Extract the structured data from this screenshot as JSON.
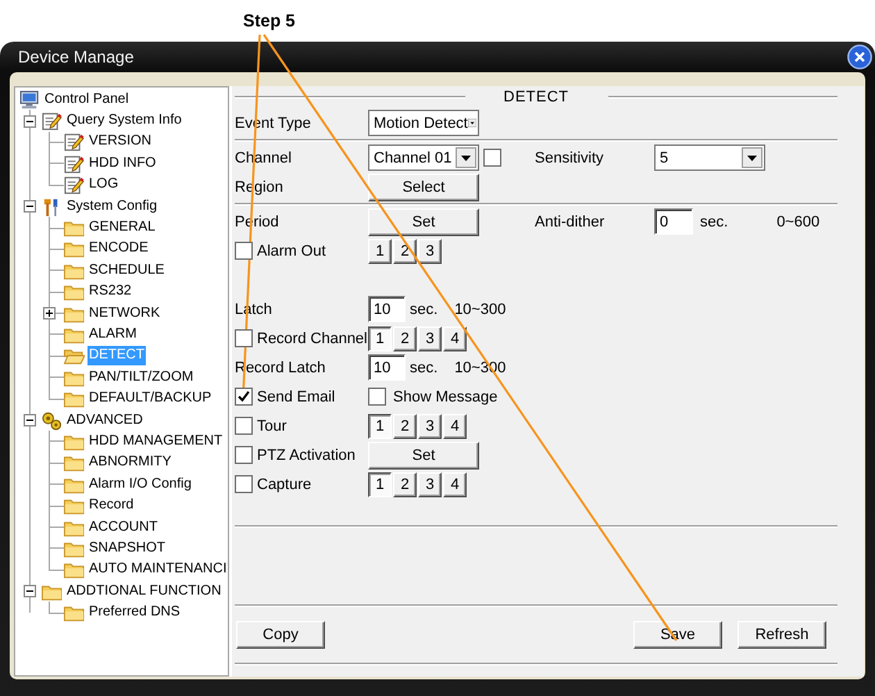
{
  "annotation": {
    "label": "Step 5"
  },
  "window": {
    "title": "Device Manage"
  },
  "tree": [
    {
      "label": "Control Panel",
      "kind": "computer",
      "selected": false,
      "children": [
        {
          "label": "Query System Info",
          "kind": "notepad",
          "selected": false,
          "expanded": true,
          "children": [
            {
              "label": "VERSION",
              "kind": "notepad",
              "selected": false
            },
            {
              "label": "HDD INFO",
              "kind": "notepad",
              "selected": false
            },
            {
              "label": "LOG",
              "kind": "notepad",
              "selected": false
            }
          ]
        },
        {
          "label": "System Config",
          "kind": "tools",
          "selected": false,
          "expanded": true,
          "children": [
            {
              "label": "GENERAL",
              "kind": "folder",
              "selected": false
            },
            {
              "label": "ENCODE",
              "kind": "folder",
              "selected": false
            },
            {
              "label": "SCHEDULE",
              "kind": "folder",
              "selected": false
            },
            {
              "label": "RS232",
              "kind": "folder",
              "selected": false
            },
            {
              "label": "NETWORK",
              "kind": "folder",
              "selected": false,
              "expanded": false
            },
            {
              "label": "ALARM",
              "kind": "folder",
              "selected": false
            },
            {
              "label": "DETECT",
              "kind": "folder-open",
              "selected": true
            },
            {
              "label": "PAN/TILT/ZOOM",
              "kind": "folder",
              "selected": false
            },
            {
              "label": "DEFAULT/BACKUP",
              "kind": "folder",
              "selected": false
            }
          ]
        },
        {
          "label": "ADVANCED",
          "kind": "gears",
          "selected": false,
          "expanded": true,
          "children": [
            {
              "label": "HDD MANAGEMENT",
              "kind": "folder",
              "selected": false
            },
            {
              "label": "ABNORMITY",
              "kind": "folder",
              "selected": false
            },
            {
              "label": "Alarm I/O Config",
              "kind": "folder",
              "selected": false
            },
            {
              "label": "Record",
              "kind": "folder",
              "selected": false
            },
            {
              "label": "ACCOUNT",
              "kind": "folder",
              "selected": false
            },
            {
              "label": "SNAPSHOT",
              "kind": "folder",
              "selected": false
            },
            {
              "label": "AUTO MAINTENANCI",
              "kind": "folder",
              "selected": false
            }
          ]
        },
        {
          "label": "ADDTIONAL FUNCTION",
          "kind": "folder",
          "selected": false,
          "expanded": true,
          "children": [
            {
              "label": "Preferred DNS",
              "kind": "folder",
              "selected": false
            }
          ]
        }
      ]
    }
  ],
  "panel": {
    "title": "DETECT",
    "rows": [
      {
        "kind": "field",
        "label": "Event Type",
        "controls": [
          {
            "kind": "select",
            "value": "Motion Detect"
          }
        ]
      },
      {
        "kind": "divider"
      },
      {
        "kind": "field",
        "label": "Channel",
        "controls": [
          {
            "kind": "select",
            "value": "Channel 01"
          },
          {
            "kind": "checkbox",
            "checked": false
          }
        ],
        "label2": "Sensitivity",
        "controls2": [
          {
            "kind": "select",
            "value": "5"
          }
        ]
      },
      {
        "kind": "field",
        "label": "Region",
        "controls": [
          {
            "kind": "button",
            "label": "Select"
          }
        ]
      },
      {
        "kind": "divider"
      },
      {
        "kind": "field",
        "label": "Period",
        "controls": [
          {
            "kind": "button",
            "label": "Set"
          }
        ],
        "label2": "Anti-dither",
        "controls2": [
          {
            "kind": "input",
            "value": "0"
          },
          {
            "kind": "text",
            "text": "sec."
          },
          {
            "kind": "text",
            "text": "0~600"
          }
        ]
      },
      {
        "kind": "check",
        "label": "Alarm Out",
        "checked": false,
        "controls": [
          {
            "kind": "toggles",
            "items": [
              {
                "label": "1",
                "selected": false
              },
              {
                "label": "2",
                "selected": false
              },
              {
                "label": "3",
                "selected": false
              }
            ]
          }
        ]
      },
      {
        "kind": "gap"
      },
      {
        "kind": "field",
        "label": "Latch",
        "controls": [
          {
            "kind": "input",
            "value": "10"
          },
          {
            "kind": "text",
            "text": "sec."
          },
          {
            "kind": "text",
            "text": "10~300"
          }
        ]
      },
      {
        "kind": "check",
        "label": "Record Channel",
        "checked": false,
        "controls": [
          {
            "kind": "toggles",
            "items": [
              {
                "label": "1",
                "selected": true
              },
              {
                "label": "2",
                "selected": false
              },
              {
                "label": "3",
                "selected": false
              },
              {
                "label": "4",
                "selected": false
              }
            ]
          }
        ]
      },
      {
        "kind": "field",
        "label": "Record Latch",
        "controls": [
          {
            "kind": "input",
            "value": "10"
          },
          {
            "kind": "text",
            "text": "sec."
          },
          {
            "kind": "text",
            "text": "10~300"
          }
        ]
      },
      {
        "kind": "check",
        "label": "Send Email",
        "checked": true,
        "controls": [
          {
            "kind": "checkbox",
            "checked": false,
            "label": "Show Message"
          }
        ]
      },
      {
        "kind": "check",
        "label": "Tour",
        "checked": false,
        "controls": [
          {
            "kind": "toggles",
            "items": [
              {
                "label": "1",
                "selected": true
              },
              {
                "label": "2",
                "selected": false
              },
              {
                "label": "3",
                "selected": false
              },
              {
                "label": "4",
                "selected": false
              }
            ]
          }
        ]
      },
      {
        "kind": "check",
        "label": "PTZ Activation",
        "checked": false,
        "controls": [
          {
            "kind": "button",
            "label": "Set"
          }
        ]
      },
      {
        "kind": "check",
        "label": "Capture",
        "checked": false,
        "controls": [
          {
            "kind": "toggles",
            "items": [
              {
                "label": "1",
                "selected": true
              },
              {
                "label": "2",
                "selected": false
              },
              {
                "label": "3",
                "selected": false
              },
              {
                "label": "4",
                "selected": false
              }
            ]
          }
        ]
      }
    ],
    "buttons": [
      {
        "label": "Copy"
      },
      {
        "label": "Save"
      },
      {
        "label": "Refresh"
      }
    ]
  }
}
